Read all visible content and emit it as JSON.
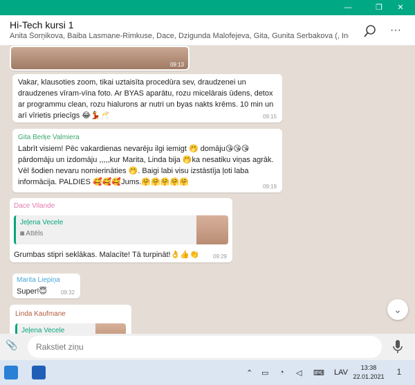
{
  "window": {
    "minimize_label": "—",
    "maximize_label": "❐",
    "close_label": "✕"
  },
  "chat": {
    "title": "Hi-Tech kursi 1",
    "members": "Anita Šorņikova, Baiba Lasmane-Rimkuse, Dace, Dzigunda Malofejeva, Gita, Gunita Serbakova (, Indra Jakobs...",
    "more_label": "···"
  },
  "messages": [
    {
      "sender": "",
      "text": "",
      "time": "09:13"
    },
    {
      "sender": "",
      "text": "Vakar, klausoties zoom, tikai uztaisīta procedūra sev, draudzenei un draudzenes vīram-vīna foto. Ar BYAS aparātu, rozu micelārais ūdens, detox ar programmu clean, rozu hialurons ar nutri un byas nakts krēms. 10 min un arī vīrietis priecīgs 😂💃🥂",
      "time": "09:15"
    },
    {
      "sender": "Gita Berķe Valmiera",
      "sender_color": "#3aa76d",
      "text": "Labrīt visiem! Pēc vakardienas nevarēju ilgi iemigt 🤭 domāju😘😘😘 pārdomāju un izdomāju ,,,,,kur Marita, Linda bija 🤭ka nesatiku viņas agrāk. Vēl šodien nevaru nomierināties 🤭. Baigi labi visu izstāstīja ļoti laba informācija. PALDIES 🥰🥰🥰Jums.🤗🤗🤗🤗🤗",
      "time": "09:19"
    },
    {
      "sender": "Dace Vilande",
      "sender_color": "#e07ab0",
      "quote_name": "Jeļena Vecele",
      "quote_type": "Attēls",
      "text": "Grumbas stipri seklākas. Malacīte! Tā turpināt!👌👍👏",
      "time": "09:29"
    },
    {
      "sender": "Marita Liepiņa",
      "sender_color": "#4aa6d8",
      "text": "Super!😇",
      "time": "09:32"
    },
    {
      "sender": "Linda Kaufmane",
      "sender_color": "#b35a3e",
      "quote_name": "Jeļena Vecele",
      "text": "",
      "time": ""
    }
  ],
  "composer": {
    "placeholder": "Rakstiet ziņu"
  },
  "taskbar": {
    "language": "LAV",
    "time": "13:38",
    "date": "22.01.2021",
    "notification_count": "1"
  },
  "colors": {
    "accent": "#00a884",
    "chat_bg": "#e5ddd5"
  }
}
